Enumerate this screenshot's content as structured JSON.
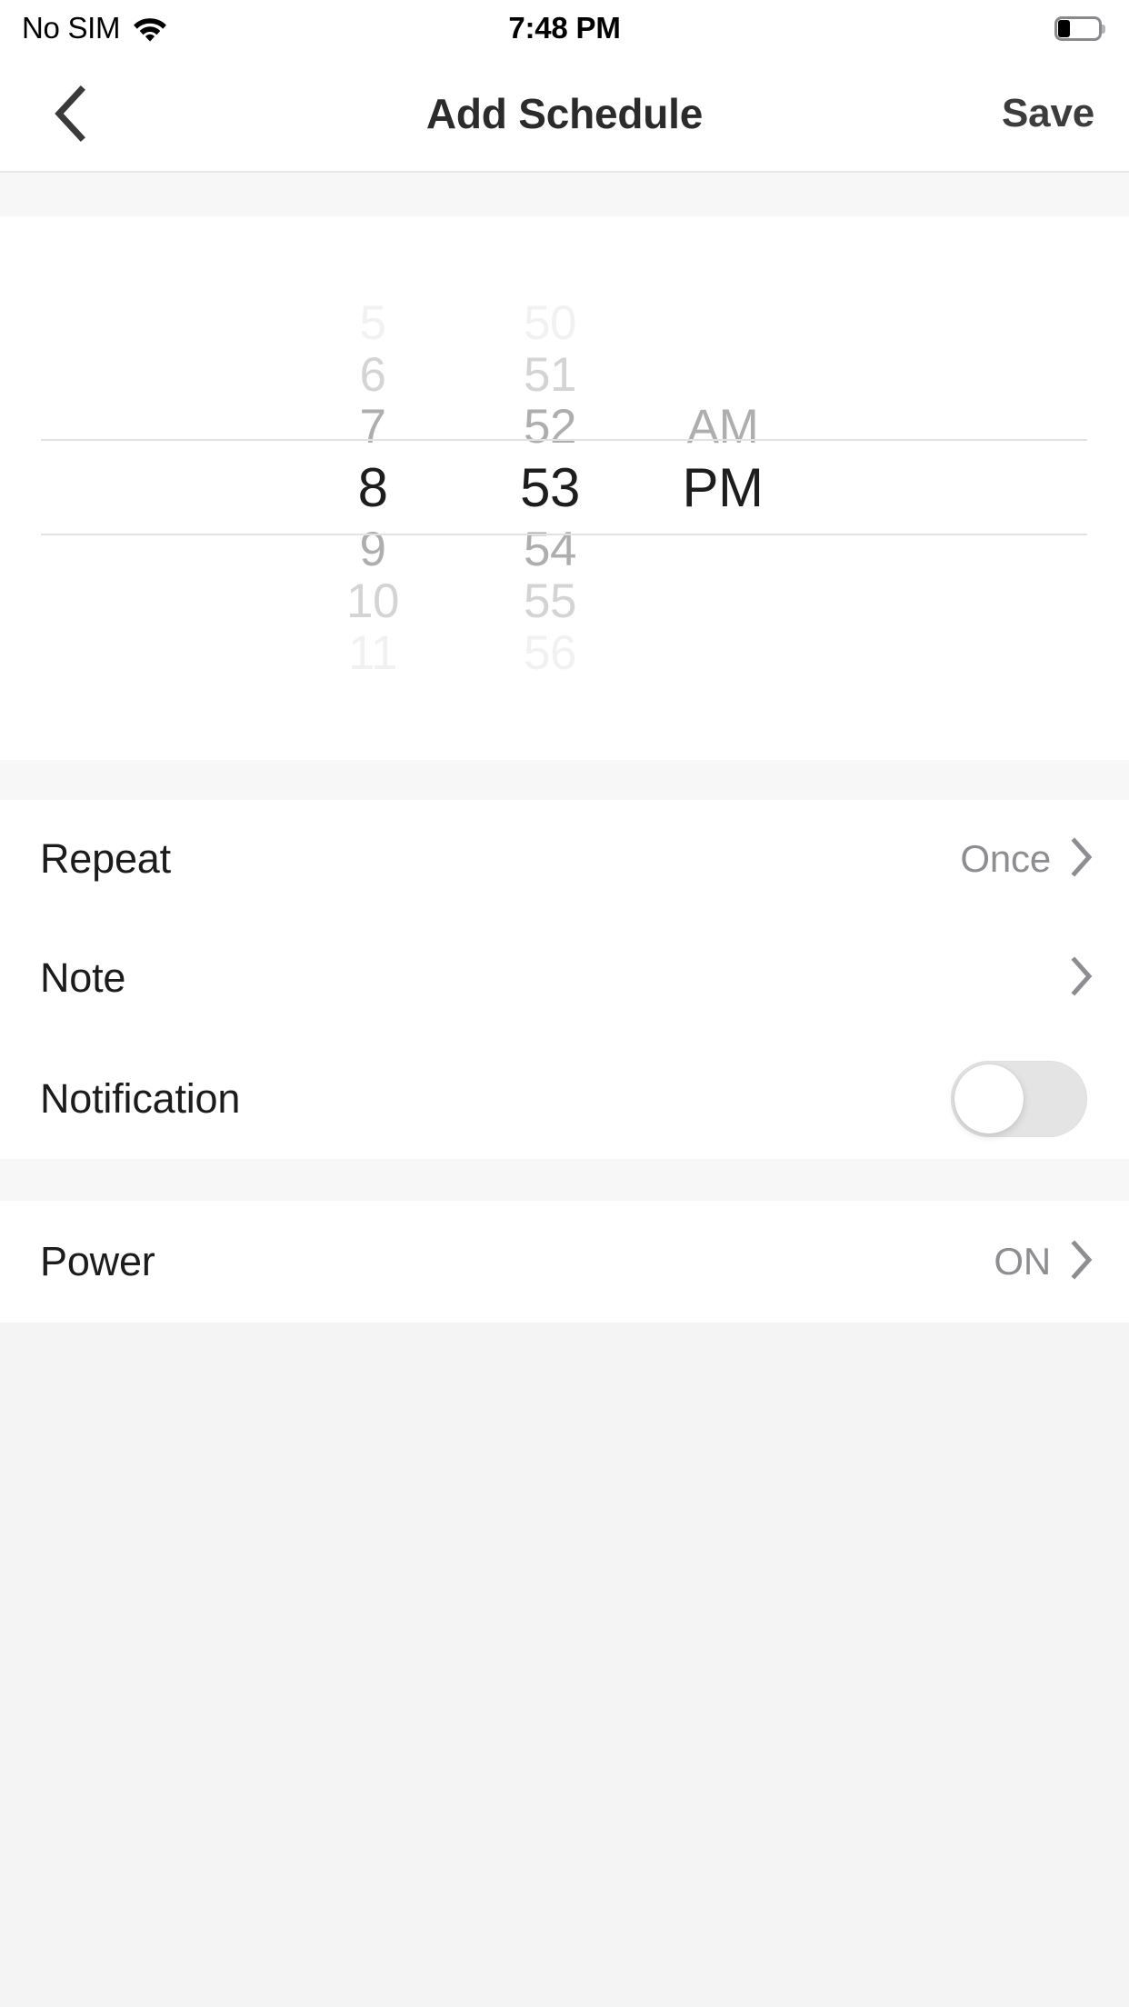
{
  "status_bar": {
    "carrier": "No SIM",
    "time": "7:48 PM",
    "wifi_icon": "wifi-icon",
    "battery_icon": "battery-low-icon",
    "battery_level_percent": 25
  },
  "nav_bar": {
    "back_icon": "chevron-left-icon",
    "title": "Add Schedule",
    "save_label": "Save"
  },
  "time_picker": {
    "selected_hour": "8",
    "selected_minute": "53",
    "selected_meridiem": "PM",
    "hours": [
      "5",
      "6",
      "7",
      "8",
      "9",
      "10",
      "11"
    ],
    "minutes": [
      "50",
      "51",
      "52",
      "53",
      "54",
      "55",
      "56"
    ],
    "meridiem_above": "AM",
    "meridiem_selected": "PM"
  },
  "settings": {
    "group_one": [
      {
        "label": "Repeat",
        "value": "Once",
        "accessory": "chevron-right-icon"
      },
      {
        "label": "Note",
        "value": "",
        "accessory": "chevron-right-icon"
      },
      {
        "label": "Notification",
        "value": "",
        "accessory": "toggle-switch",
        "toggle_on": false
      }
    ],
    "group_two": [
      {
        "label": "Power",
        "value": "ON",
        "accessory": "chevron-right-icon"
      }
    ]
  },
  "colors": {
    "page_background": "#f4f4f4",
    "card_background": "#ffffff",
    "gap_background": "#f7f7f7",
    "primary_text": "#1c1c1c",
    "secondary_text": "#8e8e92",
    "separator": "#e2e2e2",
    "toggle_off_track": "#e4e4e5",
    "toggle_knob": "#ffffff"
  }
}
